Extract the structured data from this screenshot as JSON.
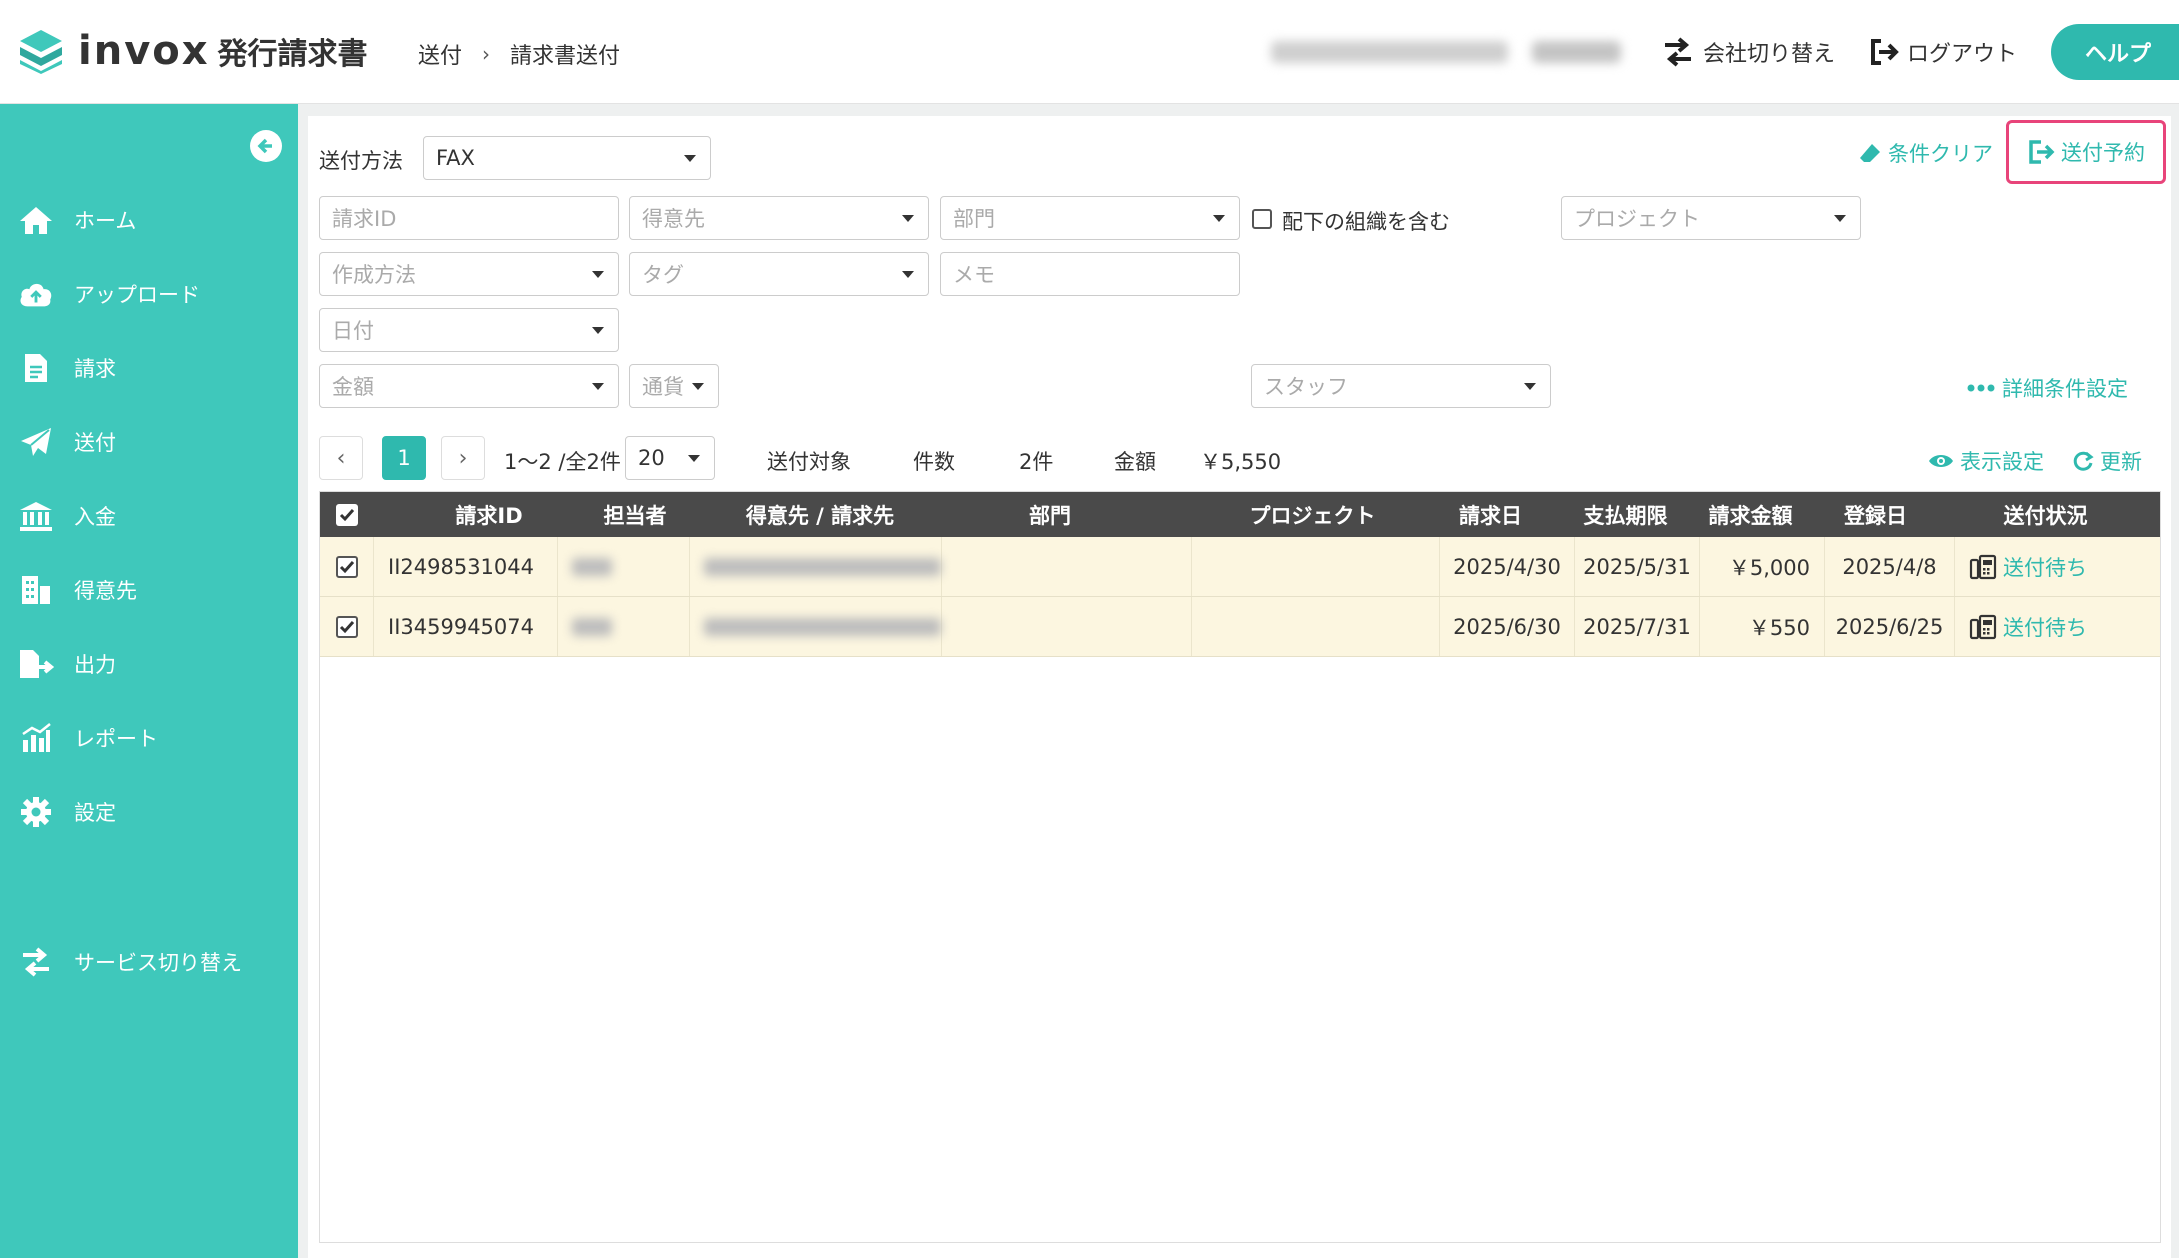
{
  "header": {
    "logo_text": "invox",
    "logo_sub": "発行請求書",
    "breadcrumb": [
      "送付",
      "請求書送付"
    ],
    "company_switch": "会社切り替え",
    "logout": "ログアウト",
    "help": "ヘルプ"
  },
  "sidebar": {
    "items": [
      {
        "label": "ホーム",
        "icon": "home-icon"
      },
      {
        "label": "アップロード",
        "icon": "cloud-upload-icon"
      },
      {
        "label": "請求",
        "icon": "document-icon"
      },
      {
        "label": "送付",
        "icon": "paper-plane-icon"
      },
      {
        "label": "入金",
        "icon": "bank-icon"
      },
      {
        "label": "得意先",
        "icon": "building-icon"
      },
      {
        "label": "出力",
        "icon": "file-export-icon"
      },
      {
        "label": "レポート",
        "icon": "chart-icon"
      },
      {
        "label": "設定",
        "icon": "gear-icon"
      }
    ],
    "service_switch": "サービス切り替え"
  },
  "filters": {
    "send_method_label": "送付方法",
    "send_method_value": "FAX",
    "clear": "条件クリア",
    "reserve": "送付予約",
    "request_id_placeholder": "請求ID",
    "customer_placeholder": "得意先",
    "dept_placeholder": "部門",
    "include_sub_label": "配下の組織を含む",
    "project_placeholder": "プロジェクト",
    "create_method_placeholder": "作成方法",
    "tag_placeholder": "タグ",
    "memo_placeholder": "メモ",
    "date_placeholder": "日付",
    "amount_placeholder": "金額",
    "currency_placeholder": "通貨",
    "staff_placeholder": "スタッフ",
    "advanced": "詳細条件設定"
  },
  "pagination": {
    "current": "1",
    "range": "1〜2 /全2件",
    "per_page": "20",
    "target_label": "送付対象",
    "count_label": "件数",
    "count_value": "2件",
    "amount_label": "金額",
    "amount_value": "￥5,550",
    "display_settings": "表示設定",
    "refresh": "更新"
  },
  "table": {
    "columns": [
      "請求ID",
      "担当者",
      "得意先 / 請求先",
      "部門",
      "プロジェクト",
      "請求日",
      "支払期限",
      "請求金額",
      "登録日",
      "送付状況"
    ],
    "rows": [
      {
        "id": "II2498531044",
        "issue_date": "2025/4/30",
        "due_date": "2025/5/31",
        "amount": "￥5,000",
        "registered": "2025/4/8",
        "status": "送付待ち"
      },
      {
        "id": "II3459945074",
        "issue_date": "2025/6/30",
        "due_date": "2025/7/31",
        "amount": "￥550",
        "registered": "2025/6/25",
        "status": "送付待ち"
      }
    ]
  }
}
